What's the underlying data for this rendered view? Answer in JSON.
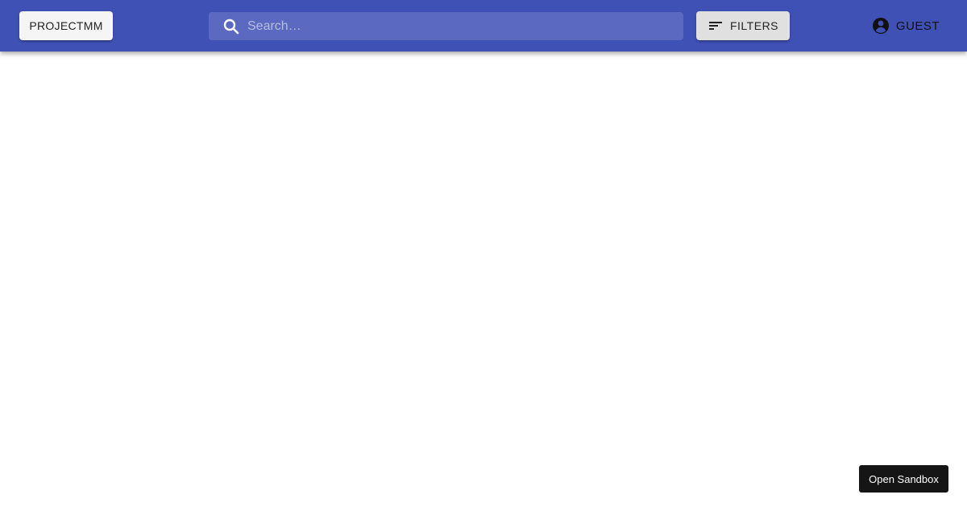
{
  "header": {
    "brand_label": "PROJECTMM",
    "search": {
      "placeholder": "Search…",
      "value": ""
    },
    "filters_label": "FILTERS",
    "account_label": "GUEST"
  },
  "footer": {
    "sandbox_label": "Open Sandbox"
  },
  "icons": {
    "search": "search-icon",
    "filters": "filter-list-icon",
    "account": "account-circle-icon"
  },
  "colors": {
    "appbar": "#3f51b5",
    "brand_button_bg": "#f5f5f5",
    "filters_button_bg": "#e0e0e0",
    "sandbox_button_bg": "#151515"
  }
}
